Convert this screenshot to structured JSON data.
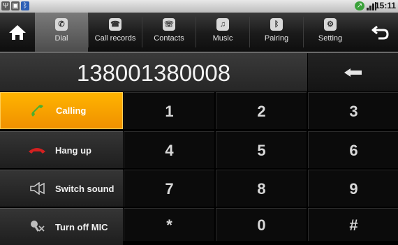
{
  "status_bar": {
    "time": "15:11",
    "icons": [
      "usb-icon",
      "android-icon",
      "bluetooth-icon",
      "call-forward-icon",
      "signal-icon"
    ]
  },
  "nav": {
    "home_icon": "home-icon",
    "back_icon": "back-arrow-icon",
    "tabs": [
      {
        "label": "Dial",
        "icon": "handset-icon",
        "active": true
      },
      {
        "label": "Call records",
        "icon": "call-log-icon"
      },
      {
        "label": "Contacts",
        "icon": "contacts-icon"
      },
      {
        "label": "Music",
        "icon": "music-icon"
      },
      {
        "label": "Pairing",
        "icon": "bluetooth-icon"
      },
      {
        "label": "Setting",
        "icon": "gear-icon"
      }
    ]
  },
  "display": {
    "number": "138001380008",
    "backspace_icon": "backspace-arrow-icon"
  },
  "actions": [
    {
      "label": "Calling",
      "icon": "green-handset-icon",
      "active": true
    },
    {
      "label": "Hang up",
      "icon": "red-handset-icon"
    },
    {
      "label": "Switch sound",
      "icon": "speaker-icon"
    },
    {
      "label": "Turn off MIC",
      "icon": "mic-off-icon"
    }
  ],
  "keypad": [
    "1",
    "2",
    "3",
    "4",
    "5",
    "6",
    "7",
    "8",
    "9",
    "*",
    "0",
    "#"
  ],
  "colors": {
    "accent": "#f5a000",
    "call_green": "#4caf2f",
    "hangup_red": "#d42020"
  }
}
